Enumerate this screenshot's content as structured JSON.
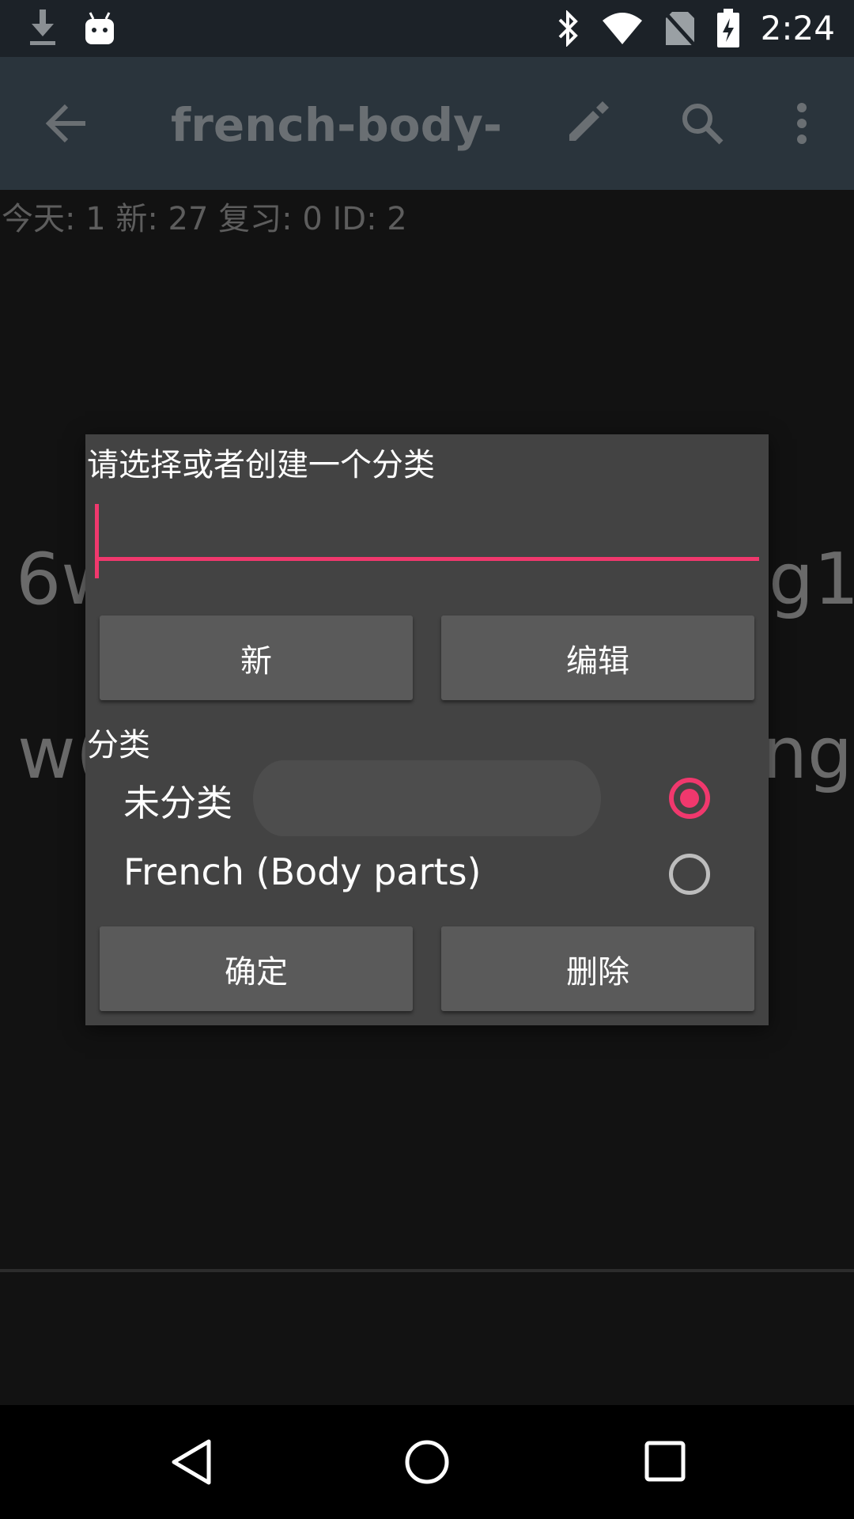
{
  "status_bar": {
    "time": "2:24",
    "icons": [
      "download-icon",
      "android-icon",
      "bluetooth-icon",
      "wifi-icon",
      "no-sim-icon",
      "battery-charging-icon"
    ]
  },
  "app_bar": {
    "title": "french-body-p…",
    "icons": [
      "back-arrow-icon",
      "edit-pencil-icon",
      "search-icon",
      "more-vert-icon"
    ]
  },
  "deck_stats": "今天: 1 新: 27 复习: 0 ID: 2",
  "background_words": {
    "line1_left": "6w",
    "line1_right": "g1",
    "line2_left": "w(",
    "line2_right": "ng"
  },
  "dialog": {
    "title": "请选择或者创建一个分类",
    "input_value": "",
    "buttons_top": {
      "new_label": "新",
      "edit_label": "编辑"
    },
    "section_label": "分类",
    "options": [
      {
        "label": "未分类",
        "selected": true
      },
      {
        "label": "French (Body parts)",
        "selected": false
      }
    ],
    "buttons_bottom": {
      "ok_label": "确定",
      "delete_label": "删除"
    }
  },
  "colors": {
    "accent": "#f0386d",
    "app_bar": "#2a343c",
    "status_bar": "#1c2228",
    "dialog_bg": "#434343",
    "button_bg": "#5a5a5a"
  }
}
